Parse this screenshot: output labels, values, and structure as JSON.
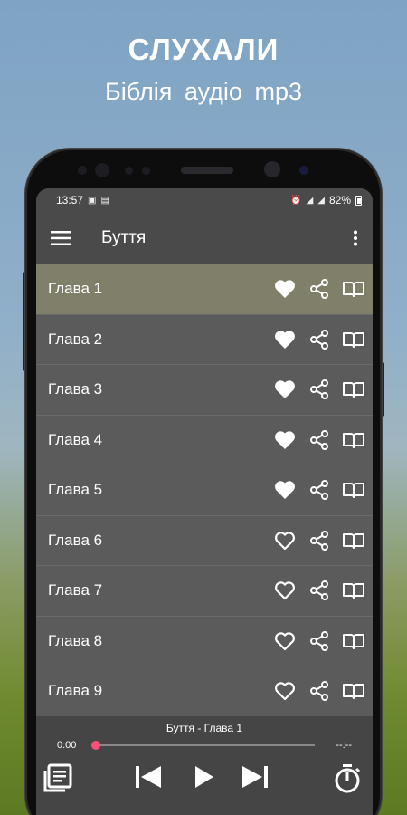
{
  "promo": {
    "title": "СЛУХАЛИ",
    "subtitle": "Біблія  аудіо mp3"
  },
  "statusbar": {
    "time": "13:57",
    "battery": "82%"
  },
  "appbar": {
    "title": "Буття"
  },
  "chapters": [
    {
      "label": "Глава 1",
      "favorite": true,
      "active": true
    },
    {
      "label": "Глава 2",
      "favorite": true,
      "active": false
    },
    {
      "label": "Глава 3",
      "favorite": true,
      "active": false
    },
    {
      "label": "Глава 4",
      "favorite": true,
      "active": false
    },
    {
      "label": "Глава 5",
      "favorite": true,
      "active": false
    },
    {
      "label": "Глава 6",
      "favorite": false,
      "active": false
    },
    {
      "label": "Глава 7",
      "favorite": false,
      "active": false
    },
    {
      "label": "Глава 8",
      "favorite": false,
      "active": false
    },
    {
      "label": "Глава 9",
      "favorite": false,
      "active": false
    }
  ],
  "player": {
    "track_title": "Буття - Глава 1",
    "current_time": "0:00",
    "duration": "--:--",
    "progress": 0
  },
  "colors": {
    "accent": "#ff4d7a",
    "active_row": "#80806a",
    "background": "#5b5b5b"
  }
}
